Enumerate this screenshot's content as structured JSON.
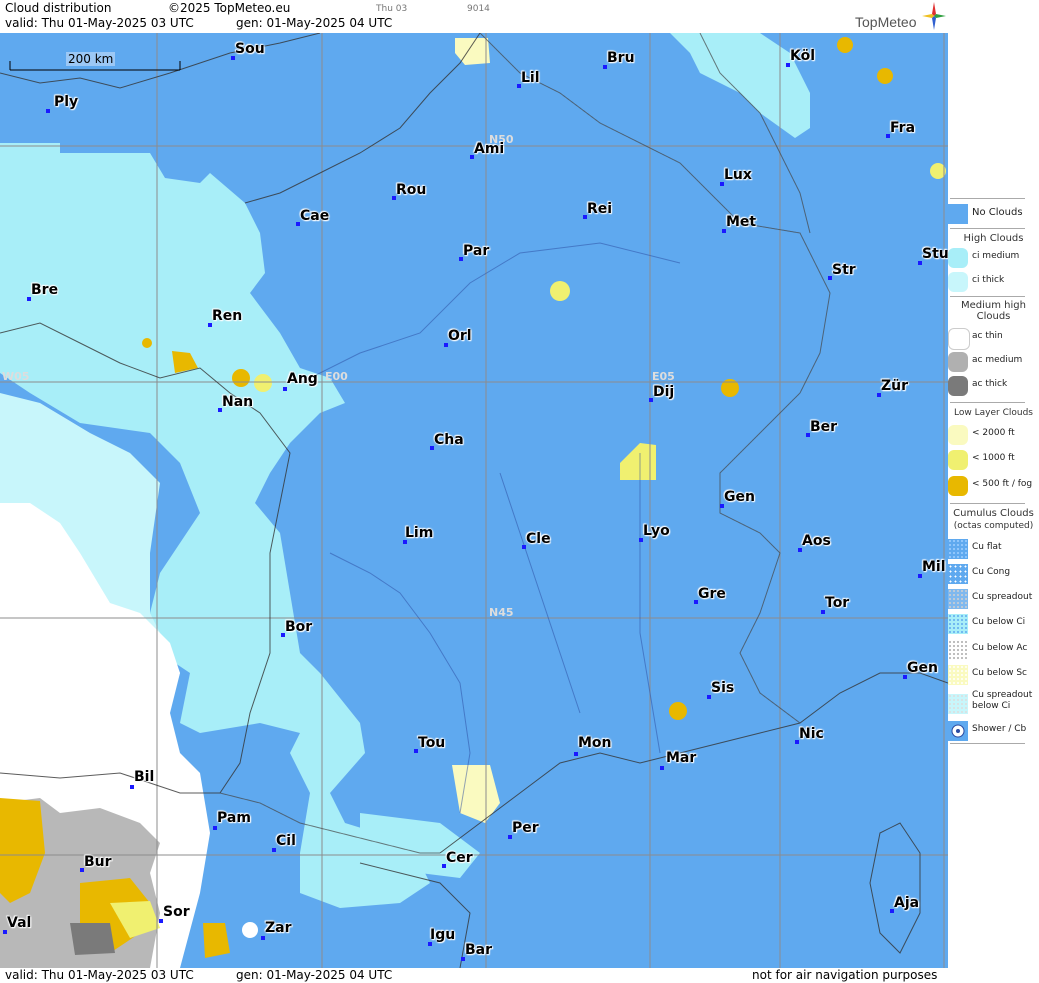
{
  "header": {
    "title": "Cloud distribution",
    "copyright": "©2025 TopMeteo.eu",
    "run_tag": "Thu 03",
    "code_tag": "9014",
    "valid_line": "valid:  Thu  01-May-2025  03 UTC",
    "gen_line": "gen: 01-May-2025 04 UTC",
    "logo_text": "TopMeteo"
  },
  "footer": {
    "valid_line": "valid:  Thu  01-May-2025  03 UTC",
    "gen_line": "gen: 01-May-2025 04 UTC",
    "disclaimer": "not for air navigation purposes"
  },
  "map": {
    "scale_label": "200 km",
    "grid_labels": [
      "N50",
      "N45",
      "W05",
      "E00",
      "E05"
    ],
    "cities": [
      "Sou",
      "Bru",
      "Köl",
      "Ply",
      "Lil",
      "Ami",
      "Fra",
      "Lux",
      "Rou",
      "Cae",
      "Rei",
      "Met",
      "Par",
      "Stu",
      "Str",
      "Bre",
      "Ren",
      "Orl",
      "Ang",
      "Nan",
      "Dij",
      "Zür",
      "Cha",
      "Ber",
      "Gen",
      "Lim",
      "Cle",
      "Lyo",
      "Aos",
      "Mil",
      "Gre",
      "Tor",
      "Bor",
      "Sis",
      "Gen",
      "Tou",
      "Mon",
      "Nic",
      "Mar",
      "Bil",
      "Pam",
      "Per",
      "Cil",
      "Cer",
      "Bur",
      "Sor",
      "Val",
      "Zar",
      "Igu",
      "Aja",
      "Bar"
    ]
  },
  "legend": {
    "no_clouds": "No Clouds",
    "high_title": "High Clouds",
    "high_items": [
      "ci medium",
      "ci thick"
    ],
    "medium_title": "Medium high Clouds",
    "medium_items": [
      "ac thin",
      "ac medium",
      "ac thick"
    ],
    "low_title": "Low Layer Clouds",
    "low_items": [
      "< 2000 ft",
      "< 1000 ft",
      "< 500 ft / fog"
    ],
    "cumulus_title": "Cumulus Clouds",
    "cumulus_subtitle": "(octas computed)",
    "cumulus_items": [
      "Cu flat",
      "Cu Cong",
      "Cu spreadout",
      "Cu below Ci",
      "Cu below Ac",
      "Cu below Sc",
      "Cu spreadout below Ci",
      "Shower / Cb"
    ],
    "colors": {
      "no_clouds": "#5fa9ef",
      "ci_medium": "#a8eef8",
      "ci_thick": "#c8f6fb",
      "ac_thin": "#ffffff",
      "ac_medium": "#b0b0b0",
      "ac_thick": "#7a7a7a",
      "low_2000": "#fafac0",
      "low_1000": "#f0f070",
      "low_500": "#e8b800"
    }
  }
}
